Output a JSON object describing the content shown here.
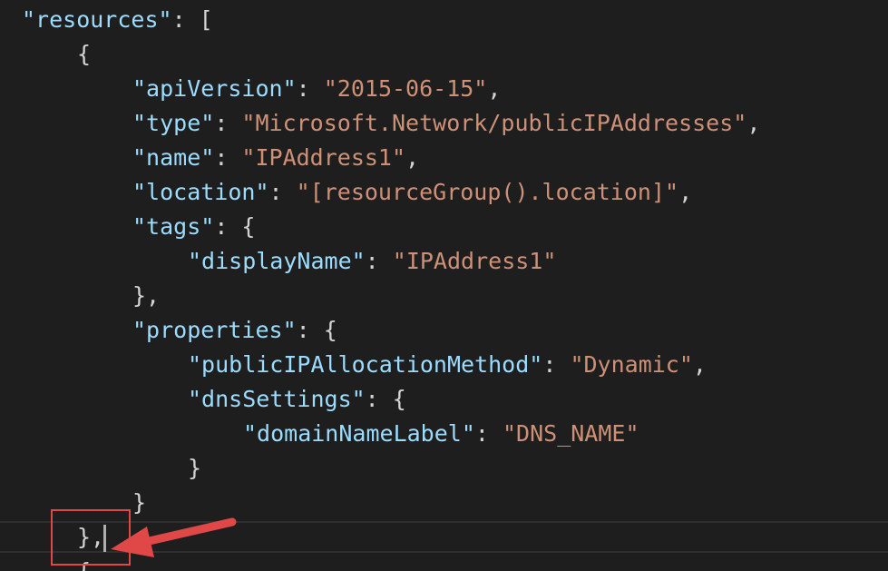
{
  "code_lines": [
    {
      "indent": 0,
      "tokens": [
        {
          "t": "key",
          "v": "\"resources\""
        },
        {
          "t": "pun",
          "v": ": ["
        }
      ]
    },
    {
      "indent": 1,
      "tokens": [
        {
          "t": "pun",
          "v": "{"
        }
      ]
    },
    {
      "indent": 2,
      "tokens": [
        {
          "t": "key",
          "v": "\"apiVersion\""
        },
        {
          "t": "pun",
          "v": ": "
        },
        {
          "t": "str",
          "v": "\"2015-06-15\""
        },
        {
          "t": "pun",
          "v": ","
        }
      ]
    },
    {
      "indent": 2,
      "tokens": [
        {
          "t": "key",
          "v": "\"type\""
        },
        {
          "t": "pun",
          "v": ": "
        },
        {
          "t": "str",
          "v": "\"Microsoft.Network/publicIPAddresses\""
        },
        {
          "t": "pun",
          "v": ","
        }
      ]
    },
    {
      "indent": 2,
      "tokens": [
        {
          "t": "key",
          "v": "\"name\""
        },
        {
          "t": "pun",
          "v": ": "
        },
        {
          "t": "str",
          "v": "\"IPAddress1\""
        },
        {
          "t": "pun",
          "v": ","
        }
      ]
    },
    {
      "indent": 2,
      "tokens": [
        {
          "t": "key",
          "v": "\"location\""
        },
        {
          "t": "pun",
          "v": ": "
        },
        {
          "t": "str",
          "v": "\"[resourceGroup().location]\""
        },
        {
          "t": "pun",
          "v": ","
        }
      ]
    },
    {
      "indent": 2,
      "tokens": [
        {
          "t": "key",
          "v": "\"tags\""
        },
        {
          "t": "pun",
          "v": ": {"
        }
      ]
    },
    {
      "indent": 3,
      "tokens": [
        {
          "t": "key",
          "v": "\"displayName\""
        },
        {
          "t": "pun",
          "v": ": "
        },
        {
          "t": "str",
          "v": "\"IPAddress1\""
        }
      ]
    },
    {
      "indent": 2,
      "tokens": [
        {
          "t": "pun",
          "v": "},"
        }
      ]
    },
    {
      "indent": 2,
      "tokens": [
        {
          "t": "key",
          "v": "\"properties\""
        },
        {
          "t": "pun",
          "v": ": {"
        }
      ]
    },
    {
      "indent": 3,
      "tokens": [
        {
          "t": "key",
          "v": "\"publicIPAllocationMethod\""
        },
        {
          "t": "pun",
          "v": ": "
        },
        {
          "t": "str",
          "v": "\"Dynamic\""
        },
        {
          "t": "pun",
          "v": ","
        }
      ]
    },
    {
      "indent": 3,
      "tokens": [
        {
          "t": "key",
          "v": "\"dnsSettings\""
        },
        {
          "t": "pun",
          "v": ": {"
        }
      ]
    },
    {
      "indent": 4,
      "tokens": [
        {
          "t": "key",
          "v": "\"domainNameLabel\""
        },
        {
          "t": "pun",
          "v": ": "
        },
        {
          "t": "str",
          "v": "\"DNS_NAME\""
        }
      ]
    },
    {
      "indent": 3,
      "tokens": [
        {
          "t": "pun",
          "v": "}"
        }
      ]
    },
    {
      "indent": 2,
      "tokens": [
        {
          "t": "pun",
          "v": "}"
        }
      ]
    },
    {
      "indent": 1,
      "tokens": [
        {
          "t": "pun",
          "v": "},"
        }
      ]
    },
    {
      "indent": 1,
      "tokens": [
        {
          "t": "pun",
          "v": "{"
        }
      ]
    }
  ],
  "current_line_index": 15,
  "colors": {
    "background": "#1e1e1e",
    "key": "#9cdcfe",
    "string": "#ce9178",
    "punctuation": "#d4d4d4",
    "annotation": "#e04848"
  },
  "annotation": {
    "box_icon": "highlight-box",
    "arrow_icon": "arrow-icon"
  }
}
